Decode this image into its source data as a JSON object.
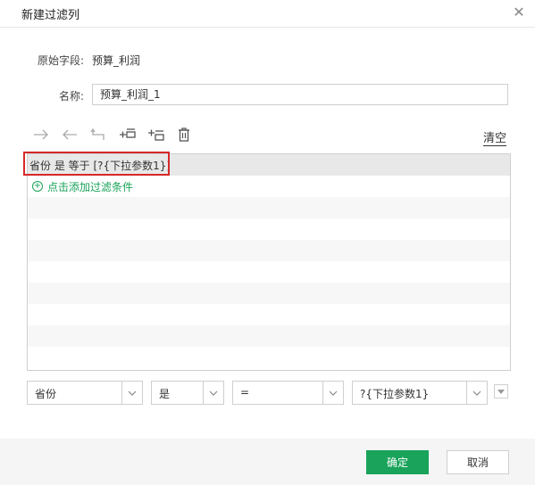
{
  "dialog": {
    "title": "新建过滤列",
    "close_icon": "close-icon"
  },
  "form": {
    "source_field_label": "原始字段:",
    "source_field_value": "预算_利润",
    "name_label": "名称:",
    "name_value": "预算_利润_1"
  },
  "toolbar": {
    "icons": [
      "arrow-right-icon",
      "arrow-left-icon",
      "corner-up-icon",
      "insert-below-icon",
      "insert-after-icon",
      "trash-icon"
    ],
    "clear_label": "清空"
  },
  "filter_list": {
    "rows": [
      {
        "text": "省份 是 等于 [?{下拉参数1}]"
      }
    ],
    "add_condition_label": "点击添加过滤条件"
  },
  "condition_editor": {
    "field_value": "省份",
    "operator_value": "是",
    "comparator_value": "=",
    "param_value": "?{下拉参数1}"
  },
  "footer": {
    "ok_label": "确定",
    "cancel_label": "取消"
  },
  "colors": {
    "accent": "#1aa35a",
    "highlight": "#d62828"
  }
}
